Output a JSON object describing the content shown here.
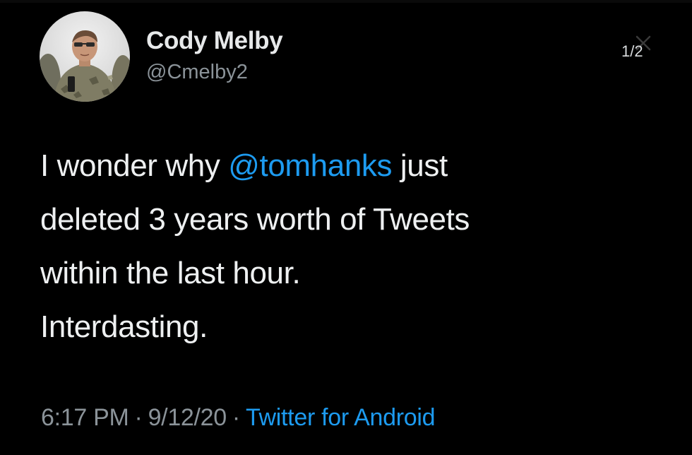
{
  "author": {
    "display_name": "Cody Melby",
    "handle": "@Cmelby2"
  },
  "viewer": {
    "page_counter": "1/2"
  },
  "tweet": {
    "line1_before": "I wonder why ",
    "mention": "@tomhanks",
    "line1_after": " just",
    "line2": "deleted 3 years worth of Tweets",
    "line3": "within the last hour.",
    "line4": "Interdasting."
  },
  "meta": {
    "time": "6:17 PM",
    "separator": "·",
    "date": "9/12/20",
    "source": "Twitter for Android"
  },
  "colors": {
    "background": "#000000",
    "link": "#1d9bf0",
    "secondary_text": "#8b9399"
  },
  "icons": {
    "close": "close-icon",
    "avatar": "profile-photo"
  }
}
